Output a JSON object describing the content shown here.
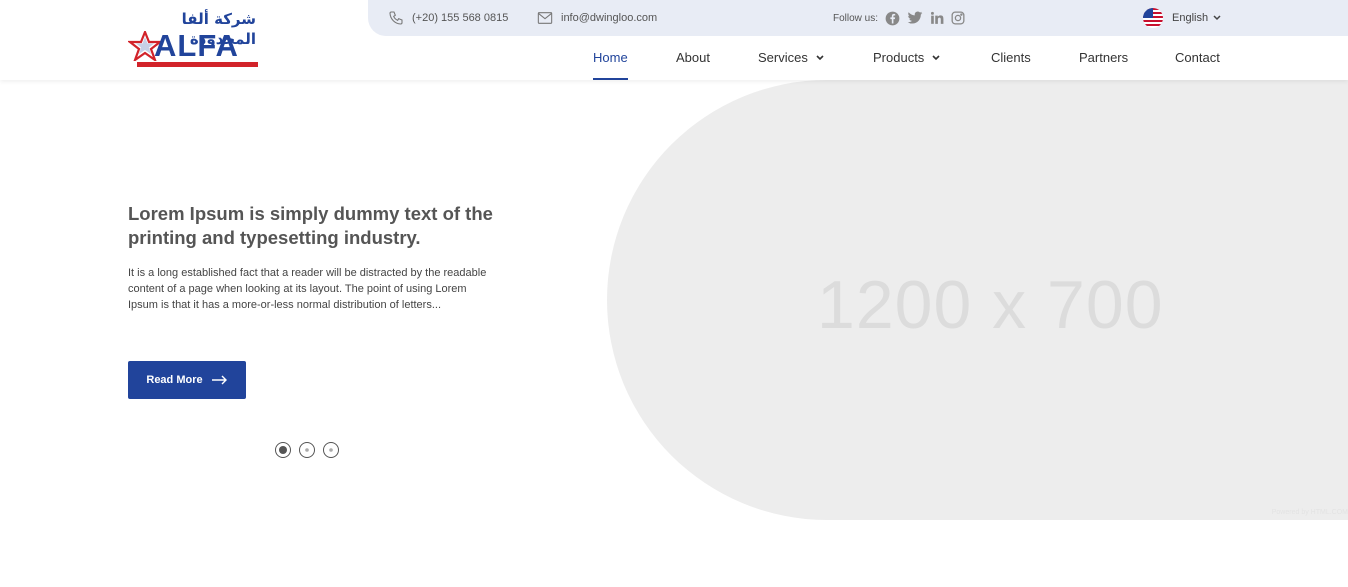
{
  "logo": {
    "arabic_text": "شركة ألفا المحدودة",
    "english_text": "ALFA"
  },
  "topbar": {
    "phone": "(+20) 155 568 0815",
    "email": "info@dwingloo.com",
    "follow_label": "Follow us:",
    "social": [
      "facebook-icon",
      "twitter-icon",
      "linkedin-icon",
      "instagram-icon"
    ],
    "language": "English"
  },
  "nav": {
    "items": [
      {
        "label": "Home",
        "active": true
      },
      {
        "label": "About"
      },
      {
        "label": "Services",
        "dropdown": true
      },
      {
        "label": "Products",
        "dropdown": true
      },
      {
        "label": "Clients"
      },
      {
        "label": "Partners"
      },
      {
        "label": "Contact"
      }
    ]
  },
  "hero": {
    "title": "Lorem Ipsum is simply dummy text of the printing and typesetting industry.",
    "text": "It is a long established fact that a reader will be distracted by the readable content of a page when looking at its layout. The point of using Lorem Ipsum is that it has a more-or-less normal distribution of letters...",
    "button_label": "Read More",
    "image_placeholder": "1200 x 700",
    "image_credit": "Powered by HTML.COM",
    "slides": 3,
    "active_slide": 1
  },
  "colors": {
    "brand_blue": "#21449b",
    "brand_red": "#d2232a",
    "topbar_bg": "#e8ecf5",
    "placeholder_bg": "#ededed"
  }
}
